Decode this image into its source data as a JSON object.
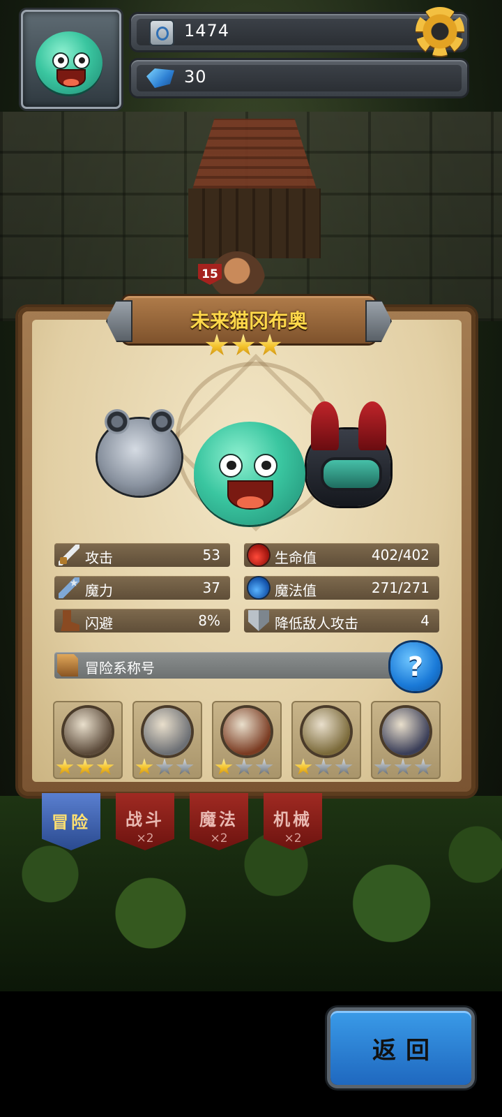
{
  "hud": {
    "currency_1": {
      "icon": "medal-coin-icon",
      "value": "1474"
    },
    "currency_2": {
      "icon": "blue-gem-icon",
      "value": "30"
    },
    "settings_icon": "gear-icon"
  },
  "background": {
    "hero_level": "15"
  },
  "card": {
    "name": "未来猫冈布奥",
    "stars": 3,
    "stats": {
      "attack": {
        "label": "攻击",
        "value": "53",
        "icon": "sword-icon"
      },
      "magic": {
        "label": "魔力",
        "value": "37",
        "icon": "magic-wand-icon"
      },
      "dodge": {
        "label": "闪避",
        "value": "8%",
        "icon": "boot-icon"
      },
      "hp": {
        "label": "生命值",
        "value": "402/402",
        "icon": "red-potion-icon"
      },
      "mp": {
        "label": "魔法值",
        "value": "271/271",
        "icon": "blue-potion-icon"
      },
      "defense": {
        "label": "降低敌人攻击",
        "value": "4",
        "icon": "shield-icon"
      }
    },
    "title_section": {
      "label": "冒险系称号",
      "help_label": "?"
    },
    "badges": [
      {
        "icon": "telescope-badge-icon",
        "stars_on": 3,
        "color": "#5b4a3a"
      },
      {
        "icon": "pig-shield-badge-icon",
        "stars_on": 1,
        "color": "#6c6f74"
      },
      {
        "icon": "treasure-sack-badge-icon",
        "stars_on": 1,
        "color": "#7a3b22"
      },
      {
        "icon": "gold-laurel-badge-icon",
        "stars_on": 1,
        "color": "#7b6a3a"
      },
      {
        "icon": "trophy-crown-badge-icon",
        "stars_on": 0,
        "color": "#3a3e58"
      }
    ]
  },
  "tabs": [
    {
      "label": "冒险",
      "sub": "",
      "active": true
    },
    {
      "label": "战斗",
      "sub": "×2",
      "active": false
    },
    {
      "label": "魔法",
      "sub": "×2",
      "active": false
    },
    {
      "label": "机械",
      "sub": "×2",
      "active": false
    }
  ],
  "back_button": {
    "label": "返回"
  }
}
